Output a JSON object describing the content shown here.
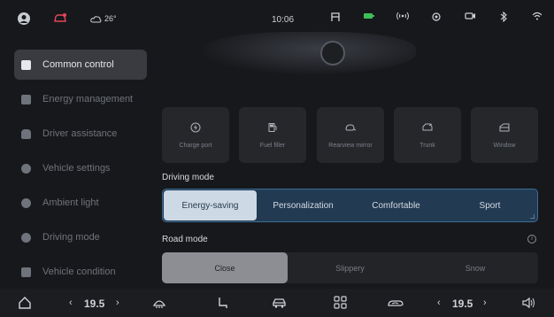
{
  "status_bar": {
    "temperature": "26°",
    "time": "10:06"
  },
  "sidebar": {
    "items": [
      {
        "label": "Common control",
        "active": true
      },
      {
        "label": "Energy management",
        "active": false
      },
      {
        "label": "Driver assistance",
        "active": false
      },
      {
        "label": "Vehicle settings",
        "active": false
      },
      {
        "label": "Ambient light",
        "active": false
      },
      {
        "label": "Driving mode",
        "active": false
      },
      {
        "label": "Vehicle condition",
        "active": false
      }
    ]
  },
  "quick_controls": [
    {
      "label": "Charge port",
      "icon": "charge-port-icon"
    },
    {
      "label": "Fuel filler",
      "icon": "fuel-filler-icon"
    },
    {
      "label": "Rearview mirror",
      "icon": "rearview-mirror-icon"
    },
    {
      "label": "Trunk",
      "icon": "trunk-icon"
    },
    {
      "label": "Window",
      "icon": "window-icon"
    }
  ],
  "driving_mode": {
    "title": "Driving mode",
    "options": [
      "Energy-saving",
      "Personalization",
      "Comfortable",
      "Sport"
    ],
    "selected": "Energy-saving"
  },
  "road_mode": {
    "title": "Road mode",
    "options": [
      "Close",
      "Slippery",
      "Snow"
    ],
    "selected": "Close"
  },
  "bottom_bar": {
    "left_temp": "19.5",
    "right_temp": "19.5"
  },
  "colors": {
    "background": "#17181b",
    "active_driving_mode": "#cdd9e5",
    "driving_bar": "#223a52",
    "driving_bar_border": "#3c6e98",
    "active_road_mode": "#8c8e93"
  }
}
